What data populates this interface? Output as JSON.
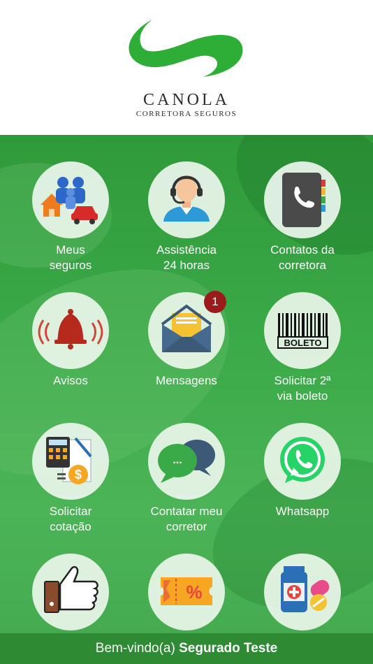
{
  "brand": {
    "name": "CANOLA",
    "tagline": "CORRETORA SEGUROS",
    "color": "#2fae37"
  },
  "menu": [
    {
      "label": "Meus\nseguros",
      "icon": "family-home-car-icon"
    },
    {
      "label": "Assistência\n24 horas",
      "icon": "headset-agent-icon"
    },
    {
      "label": "Contatos da\ncorretora",
      "icon": "phone-book-icon"
    },
    {
      "label": "Avisos",
      "icon": "bell-icon"
    },
    {
      "label": "Mensagens",
      "icon": "envelope-icon",
      "badge": "1"
    },
    {
      "label": "Solicitar 2ª\nvia boleto",
      "icon": "barcode-icon",
      "icon_text": "BOLETO"
    },
    {
      "label": "Solicitar\ncotação",
      "icon": "calculator-icon",
      "icon_text": "$"
    },
    {
      "label": "Contatar meu\ncorretor",
      "icon": "chat-bubbles-icon",
      "icon_text": "..."
    },
    {
      "label": "Whatsapp",
      "icon": "whatsapp-icon"
    },
    {
      "label": "",
      "icon": "thumbs-up-icon"
    },
    {
      "label": "",
      "icon": "discount-ticket-icon",
      "icon_text": "%"
    },
    {
      "label": "",
      "icon": "medicine-icon"
    }
  ],
  "footer": {
    "greeting": "Bem-vindo(a)",
    "user_name": "Segurado Teste"
  },
  "colors": {
    "header_bg": "#ffffff",
    "main_green": "#3aa947",
    "footer_bg": "#2e8b34",
    "badge": "#9b1b1b"
  }
}
